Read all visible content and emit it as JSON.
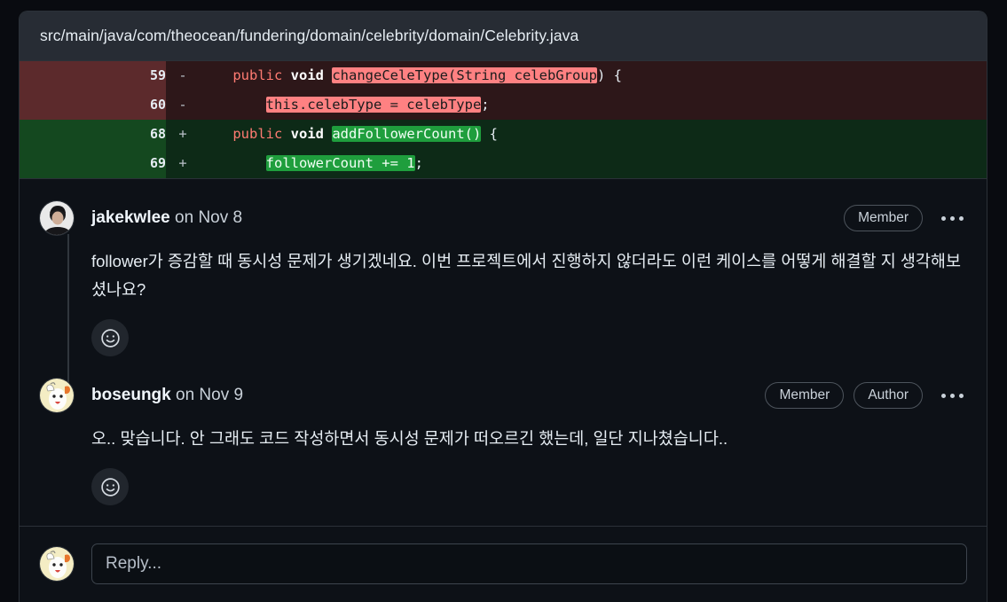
{
  "file": {
    "path": "src/main/java/com/theocean/fundering/domain/celebrity/domain/Celebrity.java"
  },
  "diff": {
    "rows": [
      {
        "type": "deletion",
        "line_number": "59",
        "sign": "-",
        "code_plain": "    public void changeCeleType(String celebGroup) {",
        "seg": {
          "indent": "    ",
          "kw": "public",
          "kw2": "void",
          "highlight": "changeCeleType(String celebGroup",
          "tail": ") {"
        }
      },
      {
        "type": "deletion",
        "line_number": "60",
        "sign": "-",
        "code_plain": "        this.celebType = celebType;",
        "seg": {
          "indent": "        ",
          "kw": "",
          "kw2": "",
          "highlight": "this.celebType = celebType",
          "tail": ";"
        }
      },
      {
        "type": "addition",
        "line_number": "68",
        "sign": "+",
        "code_plain": "    public void addFollowerCount() {",
        "seg": {
          "indent": "    ",
          "kw": "public",
          "kw2": "void",
          "highlight": "addFollowerCount()",
          "tail": " {"
        }
      },
      {
        "type": "addition",
        "line_number": "69",
        "sign": "+",
        "code_plain": "        followerCount += 1;",
        "seg": {
          "indent": "        ",
          "kw": "",
          "kw2": "",
          "highlight": "followerCount += 1",
          "tail": ";"
        }
      }
    ]
  },
  "comments": [
    {
      "author": "jakekwlee",
      "timestamp": "on Nov 8",
      "avatar_kind": "photo-person",
      "badges": [
        "Member"
      ],
      "menu_icon": "kebab-menu-icon",
      "body": "follower가 증감할 때 동시성 문제가 생기겠네요. 이번 프로젝트에서 진행하지 않더라도 이런 케이스를 어떻게 해결할 지 생각해보셨나요?",
      "reaction_icon": "smiley-add-reaction-icon"
    },
    {
      "author": "boseungk",
      "timestamp": "on Nov 9",
      "avatar_kind": "cartoon-dog",
      "badges": [
        "Member",
        "Author"
      ],
      "menu_icon": "kebab-menu-icon",
      "body": "오.. 맞습니다. 안 그래도 코드 작성하면서 동시성 문제가 떠오르긴 했는데, 일단 지나쳤습니다..",
      "reaction_icon": "smiley-add-reaction-icon"
    }
  ],
  "reply": {
    "placeholder": "Reply...",
    "avatar_kind": "cartoon-dog"
  },
  "colors": {
    "page_bg": "#090b10",
    "card_bg": "#0d1117",
    "header_bg": "#272c34",
    "deletion_gutter": "#5c2a2c",
    "deletion_body": "#2d1719",
    "addition_gutter": "#14481f",
    "addition_body": "#0d2a17",
    "deletion_highlight": "#ff8182",
    "addition_highlight": "#1f9e3d",
    "keyword": "#ff7b72",
    "text": "#e6edf3",
    "border": "#2b3138"
  }
}
